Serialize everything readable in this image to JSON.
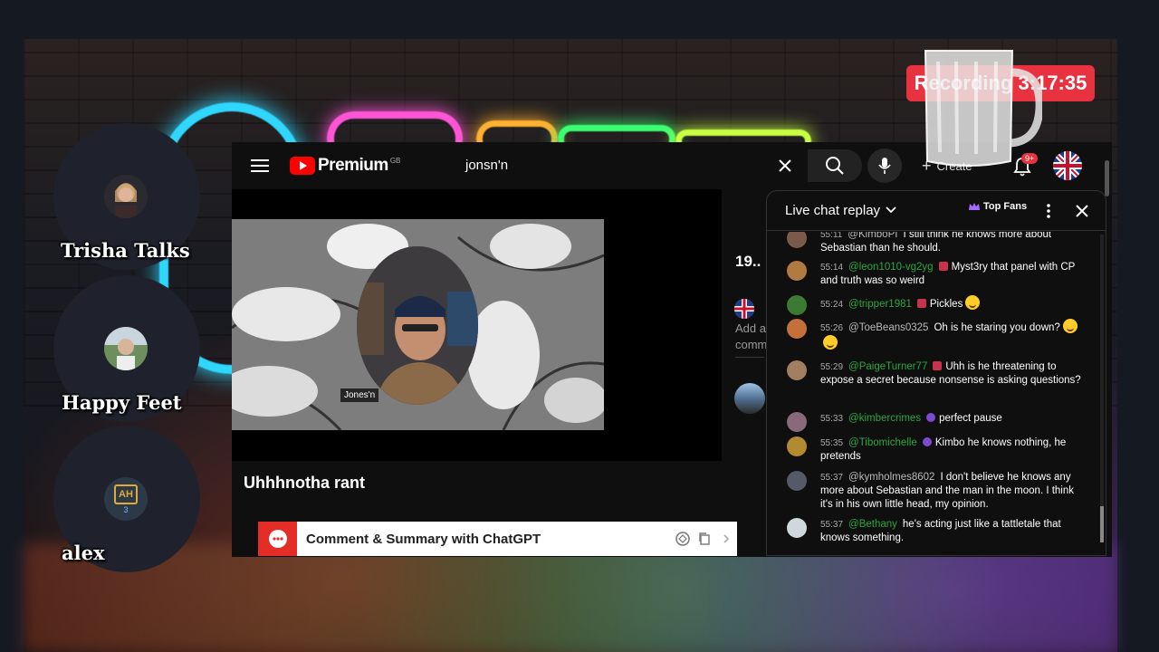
{
  "recording": {
    "label": "Recording 3:17:35",
    "color": "#e8323f"
  },
  "participants": [
    {
      "name": "Trisha Talks"
    },
    {
      "name": "Happy Feet"
    },
    {
      "name": "alex",
      "initials": "AH",
      "level": "3"
    }
  ],
  "youtube": {
    "brand": "Premium",
    "region": "GB",
    "search_query": "jonsn'n",
    "create_label": "Create",
    "notification_count": "9+",
    "video_title": "Uhhhnotha rant",
    "camera_label": "Jones'n",
    "partial_count": "19..",
    "partial_add_line1": "Add a",
    "partial_add_line2": "comm",
    "extension": {
      "label": "Comment & Summary with ChatGPT"
    }
  },
  "chat": {
    "title": "Live chat replay",
    "top_fans_label": "Top Fans",
    "messages": [
      {
        "time": "55:11",
        "author": "@KimboPI",
        "member": false,
        "mod": false,
        "text": "I still think he knows more about Sebastian than he should."
      },
      {
        "time": "55:14",
        "author": "@leon1010-vg2yg",
        "member": true,
        "mod": true,
        "text": "Myst3ry that panel with CP and truth was so weird"
      },
      {
        "time": "55:24",
        "author": "@tripper1981",
        "member": true,
        "mod": true,
        "text": "Pickles"
      },
      {
        "time": "55:26",
        "author": "@ToeBeans0325",
        "member": false,
        "mod": false,
        "text": "Oh is he staring you down?"
      },
      {
        "time": "55:29",
        "author": "@PaigeTurner77",
        "member": true,
        "mod": true,
        "text": "Uhh is he threatening to expose a secret because nonsense is asking questions?"
      },
      {
        "time": "55:33",
        "author": "@kimbercrimes",
        "member": true,
        "mod": true,
        "text": "perfect pause"
      },
      {
        "time": "55:35",
        "author": "@Tibomichelle",
        "member": true,
        "mod": true,
        "text": "Kimbo he knows nothing, he pretends"
      },
      {
        "time": "55:37",
        "author": "@kymholmes8602",
        "member": false,
        "mod": false,
        "text": "I don't believe he knows any more about Sebastian and the man in the moon. I think it's in his own little head, my opinion."
      },
      {
        "time": "55:37",
        "author": "@Bethany",
        "member": true,
        "mod": false,
        "text": "he's acting just like a tattletale that knows something."
      }
    ]
  }
}
